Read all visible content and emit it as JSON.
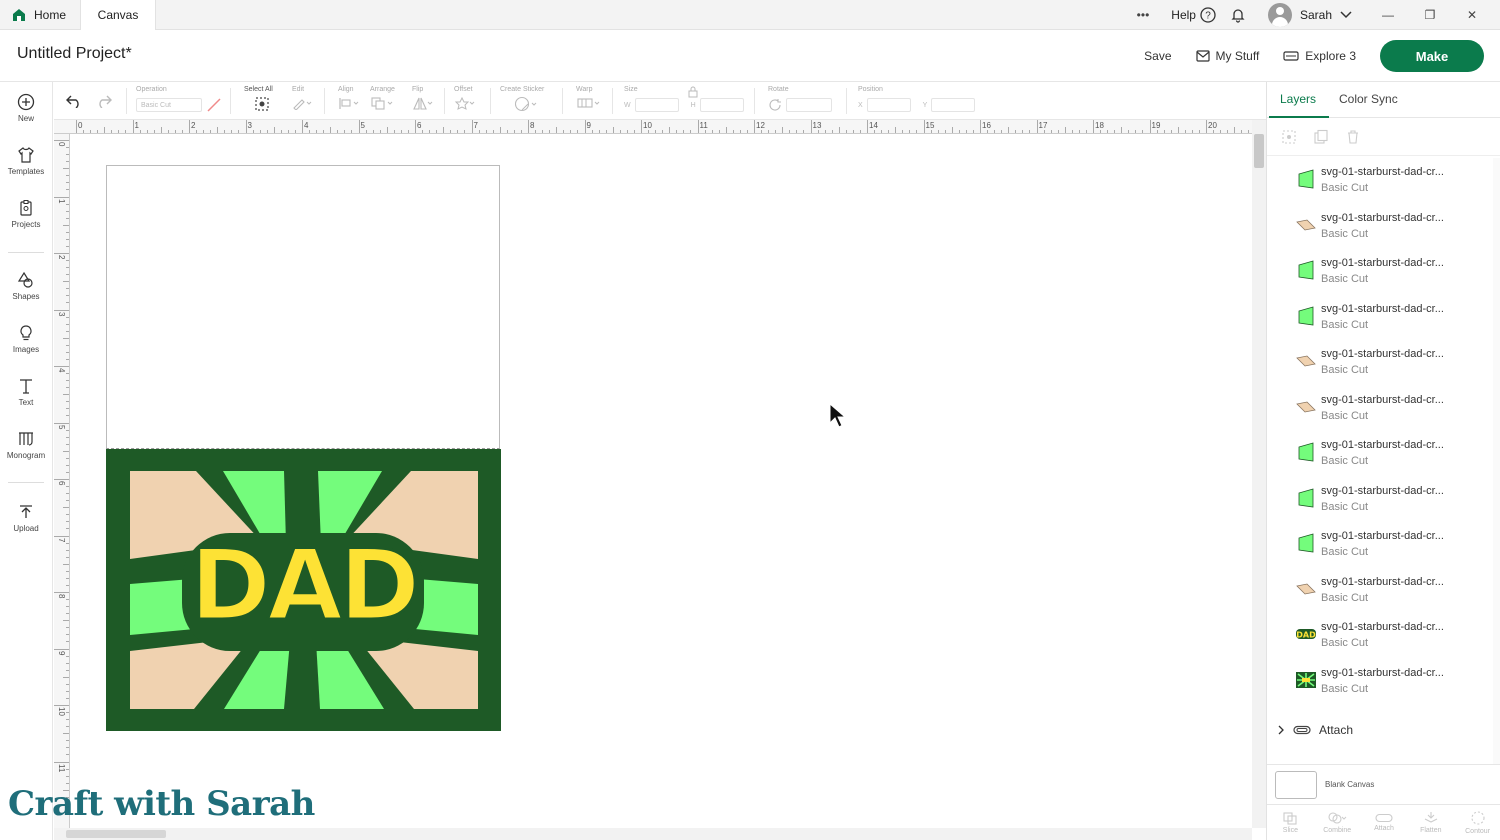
{
  "tabs": {
    "home": "Home",
    "canvas": "Canvas"
  },
  "topbar": {
    "more": "•••",
    "help": "Help",
    "user": "Sarah"
  },
  "header": {
    "project_title": "Untitled Project*",
    "save": "Save",
    "my_stuff": "My Stuff",
    "machine": "Explore 3",
    "make": "Make"
  },
  "sidebar": [
    {
      "label": "New",
      "icon": "plus-circle-icon"
    },
    {
      "label": "Templates",
      "icon": "shirt-icon"
    },
    {
      "label": "Projects",
      "icon": "clipboard-icon"
    },
    {
      "label": "Shapes",
      "icon": "shapes-icon"
    },
    {
      "label": "Images",
      "icon": "lightbulb-icon"
    },
    {
      "label": "Text",
      "icon": "text-icon"
    },
    {
      "label": "Monogram",
      "icon": "monogram-icon"
    },
    {
      "label": "Upload",
      "icon": "upload-icon"
    }
  ],
  "toolbar": {
    "operation": "Operation",
    "operation_value": "Basic Cut",
    "select_all": "Select All",
    "edit": "Edit",
    "align": "Align",
    "arrange": "Arrange",
    "flip": "Flip",
    "offset": "Offset",
    "create_sticker": "Create Sticker",
    "warp": "Warp",
    "size": "Size",
    "w": "W",
    "h": "H",
    "rotate": "Rotate",
    "position": "Position",
    "x": "X",
    "y": "Y"
  },
  "ruler": {
    "top": [
      "0",
      "1",
      "2",
      "3",
      "4",
      "5",
      "6",
      "7",
      "8",
      "9",
      "10",
      "11",
      "12",
      "13",
      "14",
      "15",
      "16",
      "17",
      "18",
      "19",
      "20"
    ],
    "left": [
      "0",
      "1",
      "2",
      "3",
      "4",
      "5",
      "6",
      "7",
      "8",
      "9",
      "10",
      "11"
    ]
  },
  "design": {
    "text": "DAD",
    "colors": {
      "dark_green": "#1e5a26",
      "light_green": "#74fc7c",
      "tan": "#f0d2b0",
      "yellow": "#fde235"
    }
  },
  "panel": {
    "tabs": [
      "Layers",
      "Color Sync"
    ],
    "layers": [
      {
        "name": "svg-01-starburst-dad-cr...",
        "op": "Basic Cut",
        "thumb": "green"
      },
      {
        "name": "svg-01-starburst-dad-cr...",
        "op": "Basic Cut",
        "thumb": "tan"
      },
      {
        "name": "svg-01-starburst-dad-cr...",
        "op": "Basic Cut",
        "thumb": "green"
      },
      {
        "name": "svg-01-starburst-dad-cr...",
        "op": "Basic Cut",
        "thumb": "green"
      },
      {
        "name": "svg-01-starburst-dad-cr...",
        "op": "Basic Cut",
        "thumb": "tan"
      },
      {
        "name": "svg-01-starburst-dad-cr...",
        "op": "Basic Cut",
        "thumb": "tan"
      },
      {
        "name": "svg-01-starburst-dad-cr...",
        "op": "Basic Cut",
        "thumb": "green"
      },
      {
        "name": "svg-01-starburst-dad-cr...",
        "op": "Basic Cut",
        "thumb": "green"
      },
      {
        "name": "svg-01-starburst-dad-cr...",
        "op": "Basic Cut",
        "thumb": "green"
      },
      {
        "name": "svg-01-starburst-dad-cr...",
        "op": "Basic Cut",
        "thumb": "tan"
      },
      {
        "name": "svg-01-starburst-dad-cr...",
        "op": "Basic Cut",
        "thumb": "dad"
      },
      {
        "name": "svg-01-starburst-dad-cr...",
        "op": "Basic Cut",
        "thumb": "starburst"
      }
    ],
    "attach": "Attach",
    "blank_canvas": "Blank Canvas",
    "bottom_tools": [
      "Slice",
      "Combine",
      "Attach",
      "Flatten",
      "Contour"
    ]
  },
  "watermark": "Craft with Sarah",
  "accent_color": "#0b7b4c"
}
